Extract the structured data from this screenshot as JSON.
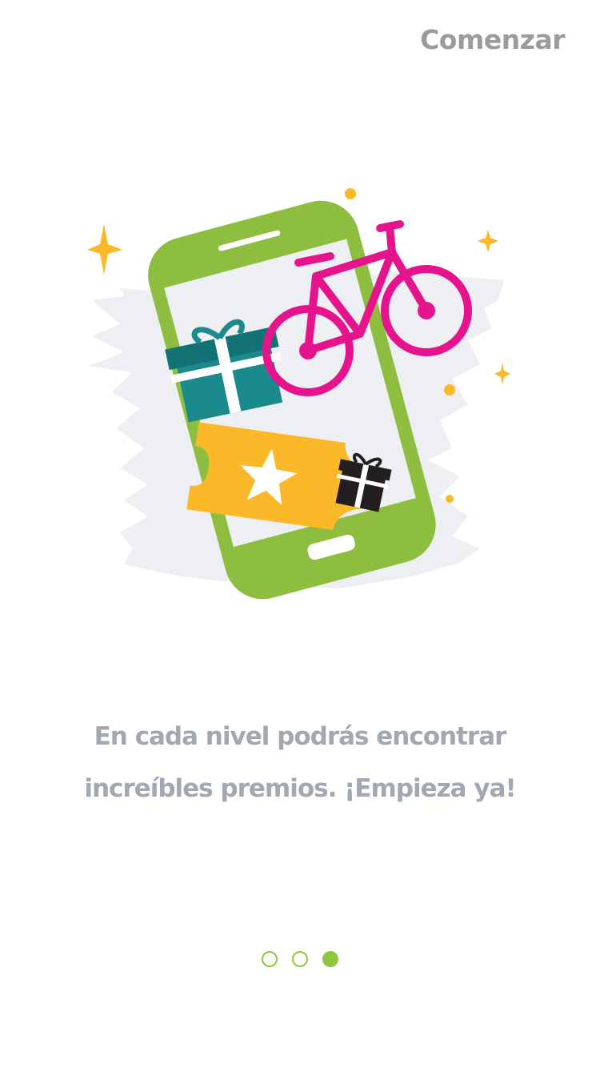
{
  "header": {
    "skip_label": "Comenzar"
  },
  "illustration": {
    "icon": "phone-with-prizes-icon",
    "colors": {
      "phone": "#8dbe3f",
      "bicycle": "#e6148c",
      "gift": "#1a8a8c",
      "ticket": "#fbb929",
      "sparkle": "#fbb929",
      "backdrop": "#eeeff3"
    }
  },
  "message": {
    "line1": "En cada nivel podrás encontrar",
    "line2": "increíbles premios. ¡Empieza ya!"
  },
  "pagination": {
    "total": 3,
    "current": 3
  },
  "colors": {
    "accent": "#8cc63f",
    "skip_text": "#9b9b9b",
    "message_text": "#a1a8b1"
  }
}
